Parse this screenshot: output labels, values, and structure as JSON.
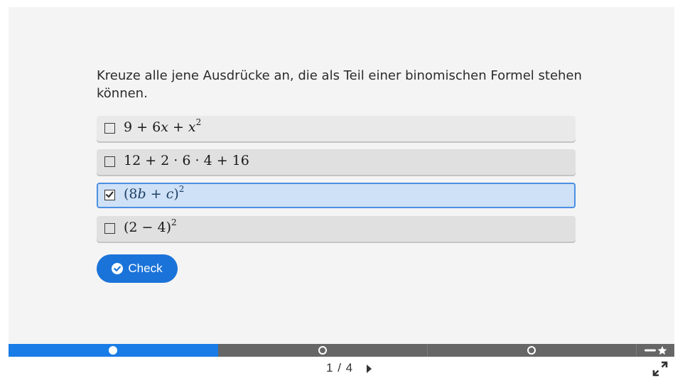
{
  "question": {
    "text": "Kreuze alle jene Ausdrücke an, die als Teil einer binomischen Formel stehen können."
  },
  "answers": [
    {
      "parts": [
        "9 + 6",
        "x",
        " + ",
        "x",
        "2"
      ],
      "checked": false
    },
    {
      "text": "12 + 2 · 6 · 4 + 16",
      "checked": false
    },
    {
      "parts": [
        "(8",
        "b",
        " + ",
        "c",
        ")",
        "2"
      ],
      "checked": true
    },
    {
      "parts": [
        "(2 − 4)",
        "2"
      ],
      "checked": false
    }
  ],
  "check_button": {
    "label": "Check",
    "icon": "check-circle-icon"
  },
  "progress": {
    "current": "1",
    "separator": "/",
    "total": "4",
    "active_color": "#1a7ce6",
    "inactive_color": "#666666"
  },
  "colors": {
    "accent": "#1a73d9",
    "selected_bg": "#cfe1f6",
    "selected_border": "#4a90e2"
  }
}
